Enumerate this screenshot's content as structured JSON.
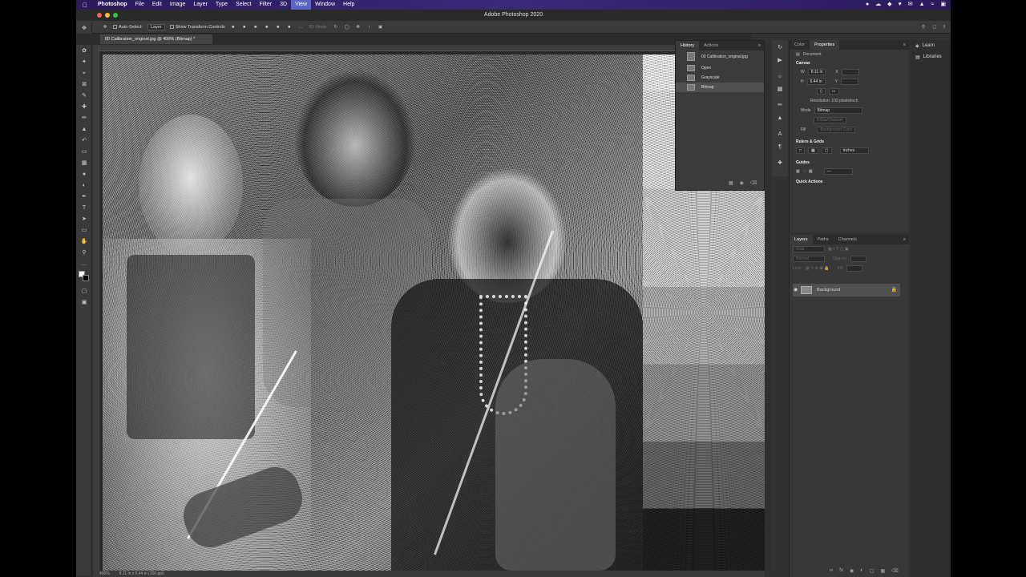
{
  "menubar": {
    "app": "Photoshop",
    "items": [
      "File",
      "Edit",
      "Image",
      "Layer",
      "Type",
      "Select",
      "Filter",
      "3D",
      "View",
      "Window",
      "Help"
    ],
    "active": "View"
  },
  "window": {
    "title": "Adobe Photoshop 2020"
  },
  "options": {
    "auto_select": "Auto-Select:",
    "layer_select": "Layer",
    "transform": "Show Transform Controls",
    "mode_3d": "3D Mode:"
  },
  "document": {
    "tab": "00 Calibration_original.jpg @ 400% (Bitmap) *",
    "zoom": "400%",
    "size_info": "8.11 in x 6.44 in (100 ppi)"
  },
  "history": {
    "tabs": [
      "History",
      "Actions"
    ],
    "snapshot": "00 Calibration_original.jpg",
    "steps": [
      "Open",
      "Grayscale",
      "Bitmap"
    ]
  },
  "properties": {
    "tabs": [
      "Color",
      "Properties"
    ],
    "type": "Document",
    "canvas_label": "Canvas",
    "w_label": "W",
    "w": "8.11 in",
    "h_label": "H",
    "h": "6.44 in",
    "x_label": "X",
    "y_label": "Y",
    "resolution": "Resolution: 100 pixels/inch",
    "mode_label": "Mode",
    "mode": "Bitmap",
    "bits": "8 Bits/Channel",
    "fill_label": "Fill",
    "fill": "Background Color",
    "rulers": "Rulers & Grids",
    "units": "Inches",
    "guides": "Guides",
    "quick": "Quick Actions"
  },
  "layers": {
    "tabs": [
      "Layers",
      "Paths",
      "Channels"
    ],
    "kind": "Kind",
    "blend": "Normal",
    "opacity": "Opacity:",
    "lock": "Lock:",
    "fill": "Fill:",
    "items": [
      "Background"
    ]
  },
  "learn": {
    "items": [
      "Learn",
      "Libraries"
    ]
  }
}
